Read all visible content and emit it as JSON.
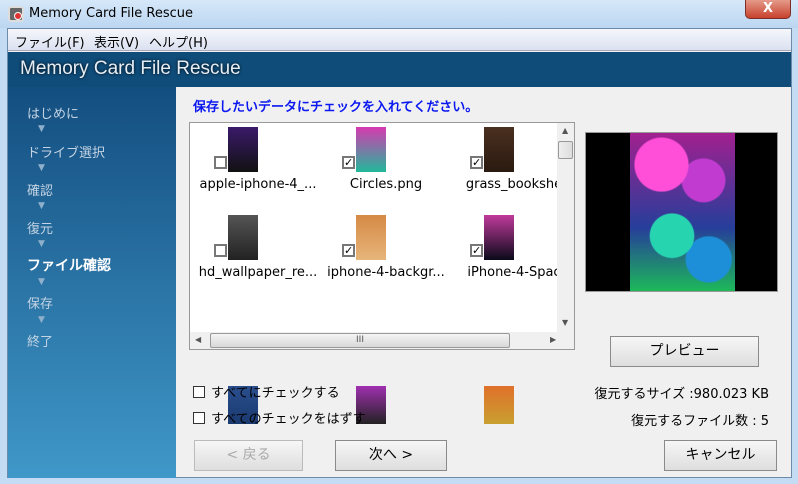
{
  "window": {
    "title": "Memory Card File Rescue",
    "close_label": "X"
  },
  "menu": [
    "ファイル(F)",
    "表示(V)",
    "ヘルプ(H)"
  ],
  "header": {
    "title": "Memory Card File Rescue"
  },
  "steps": [
    {
      "label": "はじめに",
      "active": false
    },
    {
      "label": "ドライブ選択",
      "active": false
    },
    {
      "label": "確認",
      "active": false
    },
    {
      "label": "復元",
      "active": false
    },
    {
      "label": "ファイル確認",
      "active": true
    },
    {
      "label": "保存",
      "active": false
    },
    {
      "label": "終了",
      "active": false
    }
  ],
  "step_arrow": "▼",
  "instruction": "保存したいデータにチェックを入れてください。",
  "files": [
    {
      "name": "apple-iphone-4_...",
      "checked": false,
      "colors": [
        "#3a1a6a",
        "#111"
      ]
    },
    {
      "name": "Circles.png",
      "checked": true,
      "colors": [
        "#d63ab0",
        "#21b89a"
      ]
    },
    {
      "name": "grass_bookshe",
      "checked": true,
      "colors": [
        "#4a3020",
        "#2a1a10"
      ]
    },
    {
      "name": "hd_wallpaper_re...",
      "checked": false,
      "colors": [
        "#555",
        "#222"
      ]
    },
    {
      "name": "iphone-4-backgr...",
      "checked": true,
      "colors": [
        "#d58a45",
        "#e7b57a"
      ]
    },
    {
      "name": "iPhone-4-Spac",
      "checked": true,
      "colors": [
        "#c03a9a",
        "#0a0a1a"
      ]
    },
    {
      "name": "",
      "checked": false,
      "colors": [
        "#2a4f8f",
        "#1a3a6f"
      ]
    },
    {
      "name": "",
      "checked": false,
      "colors": [
        "#a030b0",
        "#222"
      ]
    },
    {
      "name": "",
      "checked": false,
      "colors": [
        "#e0702a",
        "#c9a030"
      ]
    }
  ],
  "scroll": {
    "h_grip": "III",
    "up": "▲",
    "down": "▼",
    "left": "◀",
    "right": "▶"
  },
  "preview_button": "プレビュー",
  "check_all": "すべてにチェックする",
  "uncheck_all": "すべてのチェックをはずす",
  "restore_size": "復元するサイズ :980.023 KB",
  "restore_count": "復元するファイル数 : 5",
  "buttons": {
    "back": "< 戻る",
    "next": "次へ >",
    "cancel": "キャンセル"
  }
}
